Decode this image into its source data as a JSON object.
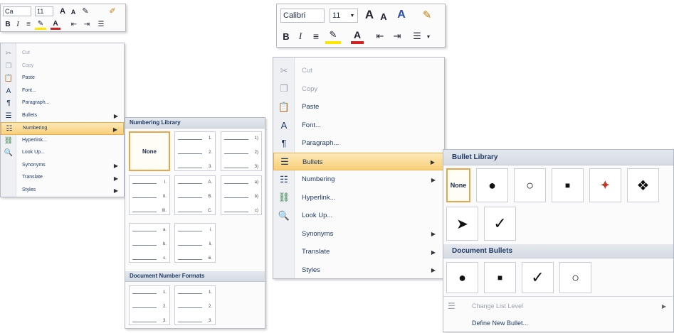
{
  "left": {
    "toolbar": {
      "font_name": "Ca",
      "font_size": "11",
      "grow_font": "A",
      "shrink_font": "A"
    },
    "menu_items": [
      {
        "label": "Cut",
        "icon": "scissors-icon",
        "disabled": true
      },
      {
        "label": "Copy",
        "icon": "copy-icon",
        "disabled": true
      },
      {
        "label": "Paste",
        "icon": "paste-icon",
        "disabled": false
      },
      {
        "label": "Font...",
        "icon": "font-icon",
        "disabled": false
      },
      {
        "label": "Paragraph...",
        "icon": "paragraph-icon",
        "disabled": false
      },
      {
        "label": "Bullets",
        "icon": "bullets-icon",
        "disabled": false,
        "submenu": true
      },
      {
        "label": "Numbering",
        "icon": "numbering-icon",
        "disabled": false,
        "submenu": true,
        "highlighted": true
      },
      {
        "label": "Hyperlink...",
        "icon": "hyperlink-icon",
        "disabled": false
      },
      {
        "label": "Look Up...",
        "icon": "lookup-icon",
        "disabled": false
      },
      {
        "label": "Synonyms",
        "icon": "",
        "disabled": false,
        "submenu": true
      },
      {
        "label": "Translate",
        "icon": "",
        "disabled": false,
        "submenu": true
      },
      {
        "label": "Styles",
        "icon": "",
        "disabled": false,
        "submenu": true
      }
    ],
    "numbering_gallery": {
      "library_header": "Numbering Library",
      "none_label": "None",
      "formats": [
        [
          "1.",
          "2.",
          "3."
        ],
        [
          "1)",
          "2)",
          "3)"
        ],
        [
          "I.",
          "II.",
          "III."
        ],
        [
          "A.",
          "B.",
          "C."
        ],
        [
          "a)",
          "b)",
          "c)"
        ],
        [
          "a.",
          "b.",
          "c."
        ],
        [
          "i.",
          "ii.",
          "iii."
        ]
      ],
      "document_header": "Document Number Formats",
      "document_formats": [
        [
          "1.",
          "2.",
          "3."
        ],
        [
          "1.",
          "2.",
          "3."
        ]
      ]
    }
  },
  "right": {
    "toolbar": {
      "font_name": "Calibri",
      "font_size": "11",
      "grow_font": "A",
      "shrink_font": "A"
    },
    "menu_items": [
      {
        "label": "Cut",
        "icon": "scissors-icon",
        "disabled": true
      },
      {
        "label": "Copy",
        "icon": "copy-icon",
        "disabled": true
      },
      {
        "label": "Paste",
        "icon": "paste-icon",
        "disabled": false
      },
      {
        "label": "Font...",
        "icon": "font-icon",
        "disabled": false
      },
      {
        "label": "Paragraph...",
        "icon": "paragraph-icon",
        "disabled": false
      },
      {
        "label": "Bullets",
        "icon": "bullets-icon",
        "disabled": false,
        "submenu": true,
        "highlighted": true
      },
      {
        "label": "Numbering",
        "icon": "numbering-icon",
        "disabled": false,
        "submenu": true
      },
      {
        "label": "Hyperlink...",
        "icon": "hyperlink-icon",
        "disabled": false
      },
      {
        "label": "Look Up...",
        "icon": "lookup-icon",
        "disabled": false
      },
      {
        "label": "Synonyms",
        "icon": "",
        "disabled": false,
        "submenu": true
      },
      {
        "label": "Translate",
        "icon": "",
        "disabled": false,
        "submenu": true
      },
      {
        "label": "Styles",
        "icon": "",
        "disabled": false,
        "submenu": true
      }
    ],
    "bullet_gallery": {
      "library_header": "Bullet Library",
      "none_label": "None",
      "library_bullets": [
        "●",
        "○",
        "■",
        "⯌",
        "❖",
        "➤",
        "✓"
      ],
      "document_header": "Document Bullets",
      "document_bullets": [
        "●",
        "■",
        "✓",
        "○"
      ],
      "change_level_label": "Change List Level",
      "define_new_label": "Define New Bullet..."
    }
  },
  "colors": {
    "highlight_top": "#fde9b8",
    "highlight_bottom": "#f8cf79",
    "header_text": "#1f3a66",
    "font_color_red": "#d22020",
    "highlighter_yellow": "#ffe600"
  }
}
